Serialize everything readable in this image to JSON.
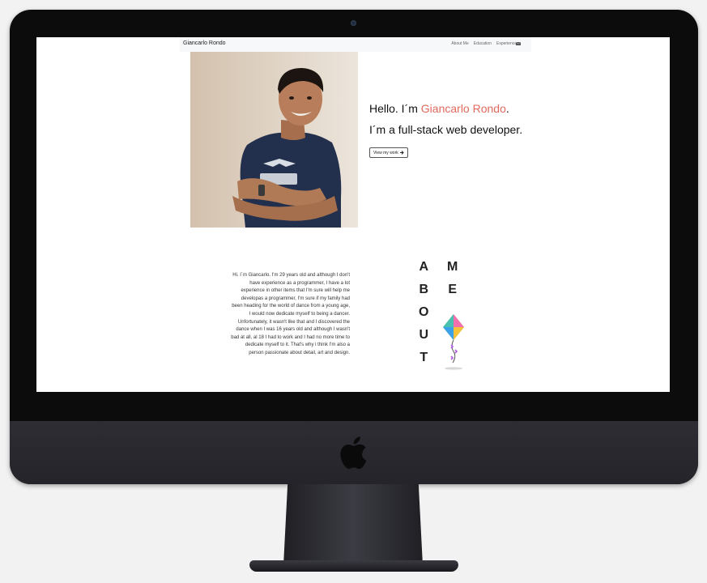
{
  "navbar": {
    "brand": "Giancarlo Rondo",
    "links": [
      "About Me",
      "Education",
      "Experience"
    ],
    "icon": "envelope-icon"
  },
  "hero": {
    "greeting_prefix": "Hello. I´m ",
    "greeting_name": "Giancarlo Rondo",
    "greeting_suffix": ".",
    "role": "I´m a full-stack web developer.",
    "button_label": "View my work",
    "button_icon": "arrow-right-icon",
    "accent_color": "#e0695c"
  },
  "about": {
    "paragraph": "Hi. I´m Giancarlo. I'm 29 years old and although I don't have experience as a programmer, I have a lot experience in other items that I'm sure will help me developas a programmer, I'm sure if my family had been heading for the world of dance from a young age, I would now dedicate myself to being a dancer. Unfortunately, it wasn't like that and I discovered the dance when I was 16 years old and although I wasn't bad at all, al 18 I had to work and I had no more time to dedicate myself to it. That's why i think I'm also a person passionate about detail, art and design.",
    "heading_col1": [
      "A",
      "B",
      "O",
      "U",
      "T"
    ],
    "heading_col2": [
      "M",
      "E"
    ],
    "illustration": "kite-icon"
  }
}
